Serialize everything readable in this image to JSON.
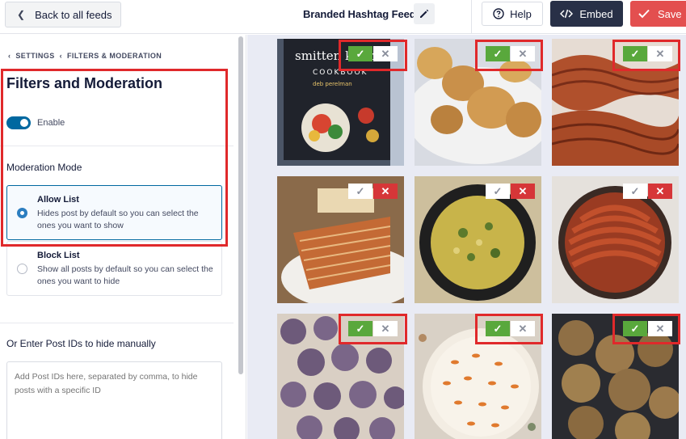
{
  "topbar": {
    "back_label": "Back to all feeds",
    "feed_title": "Branded Hashtag Feed",
    "help_label": "Help",
    "embed_label": "Embed",
    "save_label": "Save"
  },
  "sidebar": {
    "breadcrumb": [
      "SETTINGS",
      "FILTERS & MODERATION"
    ],
    "title": "Filters and Moderation",
    "enable_label": "Enable",
    "enabled": true,
    "moderation_mode_label": "Moderation Mode",
    "options": [
      {
        "title": "Allow List",
        "description": "Hides post by default so you can select the ones you want to show",
        "selected": true
      },
      {
        "title": "Block List",
        "description": "Show all posts by default so you can select the ones you want to hide",
        "selected": false
      }
    ],
    "post_ids_label": "Or Enter Post IDs to hide manually",
    "post_ids_placeholder": "Add Post IDs here, separated by comma, to hide posts with a specific ID"
  },
  "feed": {
    "posts": [
      {
        "subject": "cookbook",
        "status": "approved",
        "cover_title": "smitten kitchen",
        "cover_subtitle": "COOKBOOK",
        "cover_author": "deb perelman"
      },
      {
        "subject": "biscuits",
        "status": "approved"
      },
      {
        "subject": "bread",
        "status": "approved"
      },
      {
        "subject": "layer-cake",
        "status": "rejected"
      },
      {
        "subject": "frittata",
        "status": "rejected"
      },
      {
        "subject": "tart",
        "status": "rejected"
      },
      {
        "subject": "purple-cookies",
        "status": "approved"
      },
      {
        "subject": "carrot-cake",
        "status": "approved"
      },
      {
        "subject": "oat-cookies",
        "status": "approved"
      }
    ]
  },
  "colors": {
    "accent_blue": "#0068a0",
    "save_red": "#e34f4f",
    "embed_dark": "#283047",
    "approve_green": "#59a83c",
    "reject_red": "#d63638",
    "highlight_red": "#e0292b"
  }
}
